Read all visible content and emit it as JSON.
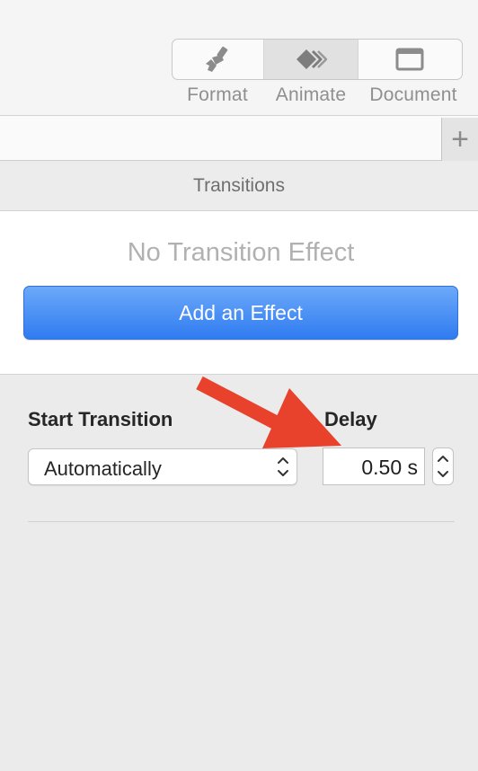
{
  "toolbar": {
    "items": [
      {
        "label": "Format",
        "icon": "paintbrush-icon"
      },
      {
        "label": "Animate",
        "icon": "animate-diamond-icon",
        "selected": true
      },
      {
        "label": "Document",
        "icon": "document-window-icon"
      }
    ]
  },
  "tabstrip": {
    "add_label": "+"
  },
  "section": {
    "title": "Transitions"
  },
  "transition": {
    "status": "No Transition Effect",
    "add_button": "Add an Effect"
  },
  "start": {
    "label": "Start Transition",
    "value": "Automatically"
  },
  "delay": {
    "label": "Delay",
    "value": "0.50 s"
  },
  "colors": {
    "accent_button": "#3b82f6",
    "annotation_arrow": "#e8412c"
  }
}
